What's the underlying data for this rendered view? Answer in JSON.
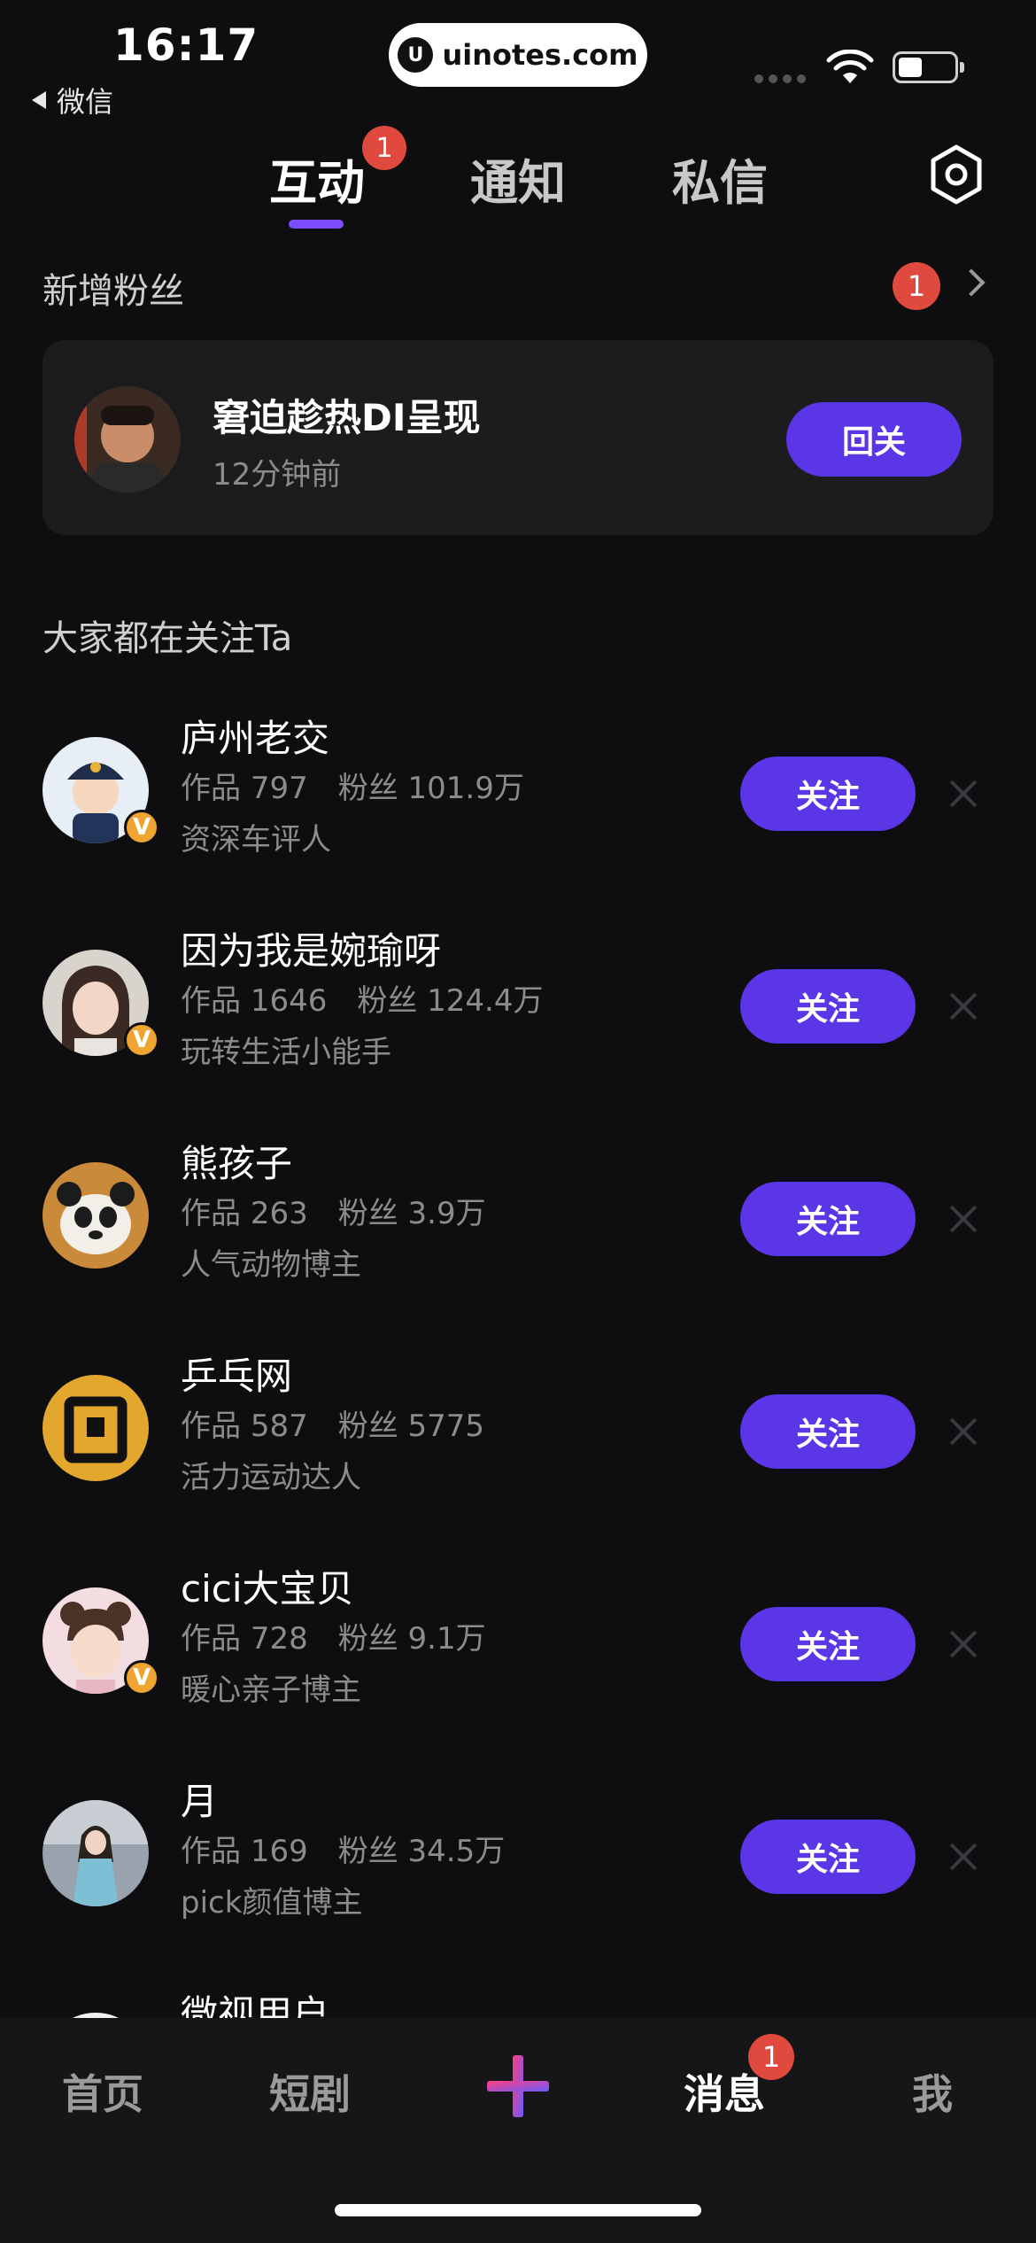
{
  "status_bar": {
    "time": "16:17",
    "back_app": "微信",
    "url": "uinotes.com",
    "url_logo": "U"
  },
  "tabs": {
    "items": [
      "互动",
      "通知",
      "私信"
    ],
    "active_index": 0,
    "badge": "1"
  },
  "new_fans": {
    "title": "新增粉丝",
    "count_badge": "1",
    "fan": {
      "name": "窘迫趁热DI呈现",
      "time": "12分钟前",
      "button": "回关"
    }
  },
  "suggested": {
    "title": "大家都在关注Ta",
    "follow_label": "关注",
    "items": [
      {
        "name": "庐州老交",
        "works_label": "作品",
        "works": "797",
        "fans_label": "粉丝",
        "fans": "101.9万",
        "desc": "资深车评人",
        "verified": true,
        "verified_mark": "V"
      },
      {
        "name": "因为我是婉瑜呀",
        "works_label": "作品",
        "works": "1646",
        "fans_label": "粉丝",
        "fans": "124.4万",
        "desc": "玩转生活小能手",
        "verified": true,
        "verified_mark": "V"
      },
      {
        "name": "熊孩子",
        "works_label": "作品",
        "works": "263",
        "fans_label": "粉丝",
        "fans": "3.9万",
        "desc": "人气动物博主",
        "verified": false
      },
      {
        "name": "乒乓网",
        "works_label": "作品",
        "works": "587",
        "fans_label": "粉丝",
        "fans": "5775",
        "desc": "活力运动达人",
        "verified": false
      },
      {
        "name": "cici大宝贝",
        "works_label": "作品",
        "works": "728",
        "fans_label": "粉丝",
        "fans": "9.1万",
        "desc": "暖心亲子博主",
        "verified": true,
        "verified_mark": "V"
      },
      {
        "name": "月",
        "works_label": "作品",
        "works": "169",
        "fans_label": "粉丝",
        "fans": "34.5万",
        "desc": "pick颜值博主",
        "verified": false
      },
      {
        "name": "微视用户"
      }
    ]
  },
  "bottom_nav": {
    "items": [
      "首页",
      "短剧",
      "消息",
      "我"
    ],
    "active": "消息",
    "messages_badge": "1"
  },
  "colors": {
    "background": "#0e0e10",
    "accent_purple": "#5a36e6",
    "tab_indicator": "#7b4dff",
    "badge_red": "#e0493e",
    "verified_gold": "#f1a531"
  }
}
